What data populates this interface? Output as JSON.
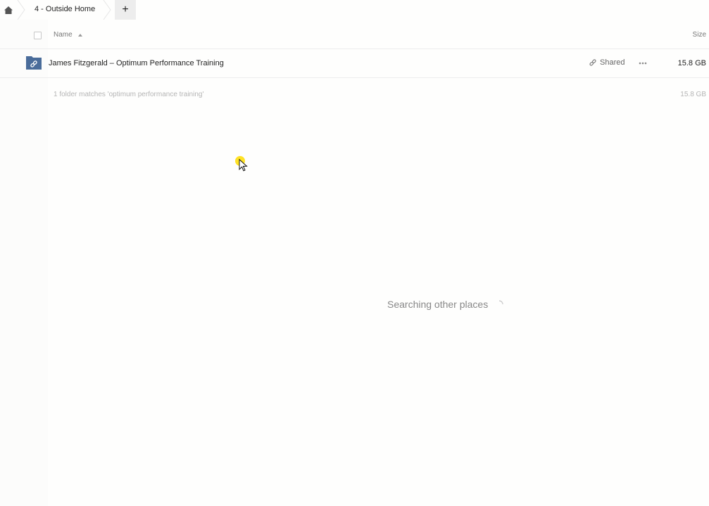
{
  "breadcrumb": {
    "home_icon": "home-icon",
    "items": [
      {
        "label": "4 - Outside Home"
      }
    ],
    "add_button_label": "+"
  },
  "table": {
    "columns": {
      "name": "Name",
      "size": "Size"
    },
    "sort": {
      "column": "Name",
      "direction": "ascending"
    },
    "rows": [
      {
        "icon": "shared-folder-icon",
        "name": "James Fitzgerald – Optimum Performance Training",
        "shared_label": "Shared",
        "size": "15.8 GB"
      }
    ],
    "summary": {
      "text": "1 folder matches 'optimum performance training'",
      "size": "15.8 GB"
    }
  },
  "status": {
    "searching_text": "Searching other places"
  },
  "colors": {
    "folder": "#4a6c9a",
    "cursor_highlight": "#ffdd00",
    "divider": "#ededed"
  }
}
